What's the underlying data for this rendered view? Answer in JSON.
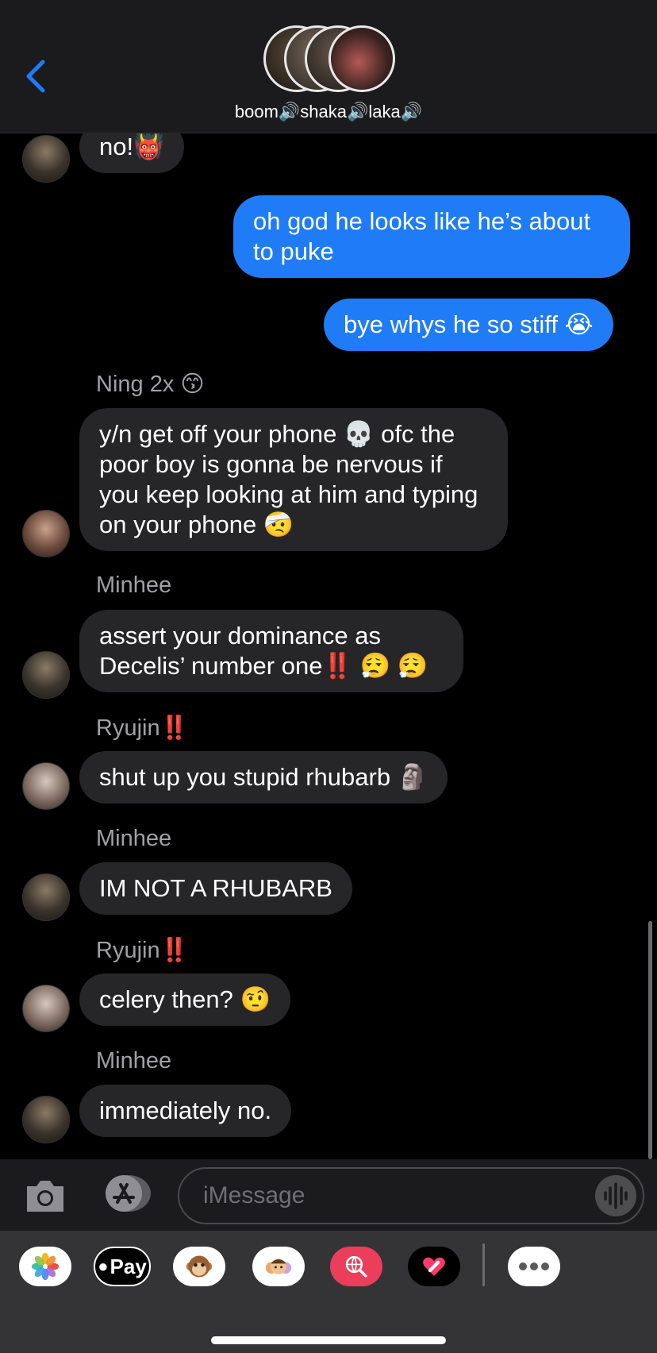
{
  "header": {
    "group_name": "boom🔊shaka🔊laka🔊",
    "back_icon": "chevron-left-icon",
    "accent": "#1f7cf6"
  },
  "messages": [
    {
      "side": "in",
      "sender": "",
      "text": "no!👹"
    },
    {
      "side": "out",
      "sender": "",
      "text": "oh god he looks like he’s about to puke"
    },
    {
      "side": "out",
      "sender": "",
      "text": "bye whys he so stiff 😭"
    },
    {
      "side": "in",
      "sender": "Ning 2x 😙",
      "text": "y/n get off your phone 💀 ofc the poor boy is gonna be nervous if you keep looking at him and typing on your phone 🤕"
    },
    {
      "side": "in",
      "sender": "Minhee",
      "text": "assert your dominance as Decelis’ number one‼️ 😮‍💨 😮‍💨"
    },
    {
      "side": "in",
      "sender": "Ryujin‼️",
      "text": "shut up you stupid rhubarb 🗿"
    },
    {
      "side": "in",
      "sender": "Minhee",
      "text": "IM NOT A RHUBARB"
    },
    {
      "side": "in",
      "sender": "Ryujin‼️",
      "text": "celery then? 🤨"
    },
    {
      "side": "in",
      "sender": "Minhee",
      "text": "immediately no."
    }
  ],
  "input": {
    "placeholder": "iMessage",
    "camera_icon": "camera-icon",
    "apps_icon": "app-store-icon",
    "audio_icon": "audio-waveform-icon"
  },
  "drawer": {
    "apps": [
      {
        "name": "photos-icon"
      },
      {
        "name": "apple-pay-icon",
        "label": "Pay"
      },
      {
        "name": "animoji-icon"
      },
      {
        "name": "memoji-icon"
      },
      {
        "name": "web-images-icon"
      },
      {
        "name": "digital-touch-icon"
      },
      {
        "name": "more-icon"
      }
    ]
  },
  "colors": {
    "incoming_bubble": "#262628",
    "outgoing_bubble": "#1f7cf6",
    "background": "#000000",
    "sender_name": "#a0a0a5"
  }
}
